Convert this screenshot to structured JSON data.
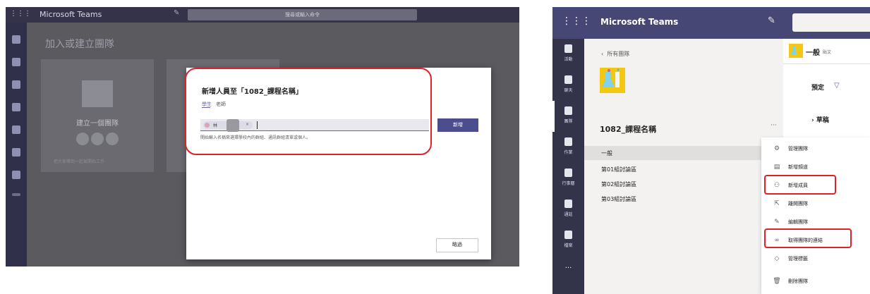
{
  "left": {
    "app_title": "Microsoft Teams",
    "search_placeholder": "搜尋或輸入命令",
    "heading": "加入或建立團隊",
    "create_card": {
      "title": "建立一個團隊",
      "description": "把大家帶到一起並開始工作"
    },
    "dialog": {
      "title": "新增人員至「1082_課程名稱」",
      "tabs": [
        "學生",
        "老師"
      ],
      "chip_name": "林",
      "chip_remove": "×",
      "add_button": "新增",
      "hint": "開始輸入名稱來選擇學校內的群組、通訊群組清單或個人。",
      "skip_button": "略過"
    },
    "highlight_color": "#e0202a"
  },
  "right": {
    "app_title": "Microsoft Teams",
    "rail": [
      {
        "icon": "bell-icon",
        "label": "活動"
      },
      {
        "icon": "chat-icon",
        "label": "聊天"
      },
      {
        "icon": "teams-icon",
        "label": "團隊"
      },
      {
        "icon": "assignments-icon",
        "label": "作業"
      },
      {
        "icon": "calendar-icon",
        "label": "行事曆"
      },
      {
        "icon": "phone-icon",
        "label": "通話"
      },
      {
        "icon": "files-icon",
        "label": "檔案"
      }
    ],
    "rail_more": "···",
    "back_label": "所有團隊",
    "team_name": "1082_課程名稱",
    "team_more": "···",
    "channels": [
      "一般",
      "第01組討論區",
      "第02組討論區",
      "第03組討論區"
    ],
    "content": {
      "title": "一般",
      "tab": "貼文",
      "default_label": "預定",
      "draft_label": "草稿"
    },
    "menu": [
      {
        "icon": "gear-icon",
        "label": "管理團隊"
      },
      {
        "icon": "channel-icon",
        "label": "新增頻道"
      },
      {
        "icon": "add-member-icon",
        "label": "新增成員"
      },
      {
        "icon": "leave-icon",
        "label": "離開團隊"
      },
      {
        "icon": "edit-icon",
        "label": "編輯團隊"
      },
      {
        "icon": "link-icon",
        "label": "取得團隊的連結"
      },
      {
        "icon": "tag-icon",
        "label": "管理標籤"
      },
      {
        "icon": "trash-icon",
        "label": "刪除團隊"
      }
    ],
    "accent_color": "#464775",
    "highlight_color": "#e0202a"
  }
}
